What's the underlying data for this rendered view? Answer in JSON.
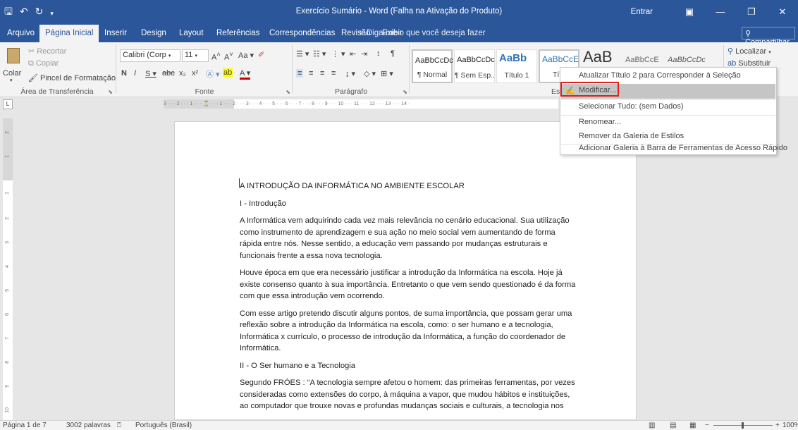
{
  "titlebar": {
    "title": "Exercício Sumário  -  Word (Falha na Ativação do Produto)",
    "signin": "Entrar",
    "icons": [
      "save-icon",
      "undo-icon",
      "redo-icon",
      "customize-qat-icon",
      "ribbon-display-icon",
      "minimize-icon",
      "restore-icon",
      "close-icon"
    ]
  },
  "tabs": {
    "items": [
      "Arquivo",
      "Página Inicial",
      "Inserir",
      "Design",
      "Layout",
      "Referências",
      "Correspondências",
      "Revisão",
      "Exibir"
    ],
    "tellme": "Diga-me o que você deseja fazer",
    "share": "Compartilhar"
  },
  "ribbon": {
    "clipboard": {
      "paste": "Colar",
      "cut": "Recortar",
      "copy": "Copiar",
      "format_painter": "Pincel de Formatação",
      "label": "Área de Transferência"
    },
    "font": {
      "name": "Calibri (Corp",
      "size": "11",
      "label": "Fonte"
    },
    "paragraph": {
      "label": "Parágrafo"
    },
    "styles": {
      "label": "Est",
      "items": [
        {
          "preview": "AaBbCcDc",
          "name": "¶ Normal"
        },
        {
          "preview": "AaBbCcDc",
          "name": "¶ Sem Esp..."
        },
        {
          "preview": "AaBb",
          "name": "Título 1"
        },
        {
          "preview": "AaBbCcE",
          "name": "Títu"
        },
        {
          "preview": "AaB",
          "name": ""
        },
        {
          "preview": "AaBbCcE",
          "name": ""
        },
        {
          "preview": "AaBbCcDc",
          "name": ""
        }
      ]
    },
    "editing": {
      "find": "Localizar",
      "replace": "Substituir"
    }
  },
  "ruler": {
    "text": "3 · · · 2 · · · 1 · · · ⌛ · · · 1 · · · 2 · · · 3 · · · 4 · · · 5 · · · 6 · · · 7 · · · 8 · · · 9 · · · 10 · · · 11 · · · 12 · · · 13 · · · 14 ·",
    "vertical": [
      "2",
      "1",
      "1",
      "2",
      "3",
      "4",
      "5",
      "6",
      "7",
      "8",
      "9",
      "10"
    ]
  },
  "document": {
    "paragraphs": [
      "A INTRODUÇÃO DA INFORMÁTICA NO AMBIENTE ESCOLAR",
      "I - Introdução",
      "A Informática vem adquirindo cada vez mais relevância no cenário educacional. Sua utilização como instrumento de aprendizagem e sua ação no meio social vem aumentando de forma rápida entre nós. Nesse sentido, a educação vem passando por mudanças estruturais e funcionais frente a essa nova tecnologia.",
      "Houve época em que era necessário justificar a introdução da Informática na escola. Hoje já existe consenso quanto à sua importância. Entretanto o que vem sendo questionado é da forma com que essa introdução vem ocorrendo.",
      "Com esse artigo pretendo discutir alguns pontos, de suma importância, que possam gerar uma reflexão sobre a introdução da Informática na escola, como: o ser humano e a tecnologia, Informática x currículo, o processo de introdução da Informática, a função do coordenador de Informática.",
      "II - O Ser humano e a Tecnologia",
      "Segundo FRÓES : “A tecnologia sempre afetou o homem: das primeiras ferramentas, por vezes consideradas como extensões do corpo, à máquina a vapor, que mudou hábitos e instituições, ao computador que trouxe novas e profundas mudanças sociais e culturais, a tecnologia nos"
    ]
  },
  "context_menu": {
    "items": [
      "Atualizar Título 2 para Corresponder à Seleção",
      "Modificar...",
      "Selecionar Tudo: (sem Dados)",
      "Renomear...",
      "Remover da Galeria de Estilos",
      "Adicionar Galeria à Barra de Ferramentas de Acesso Rápido"
    ],
    "highlighted": "Modificar...",
    "highlight_color": "#e0201a"
  },
  "statusbar": {
    "page": "Página 1 de 7",
    "words": "3002 palavras",
    "language": "Português (Brasil)",
    "zoom": "100%"
  },
  "colors": {
    "accent": "#2b579a",
    "ribbon_bg": "#f3f3f3",
    "menu_hover": "#c5c5c5"
  }
}
